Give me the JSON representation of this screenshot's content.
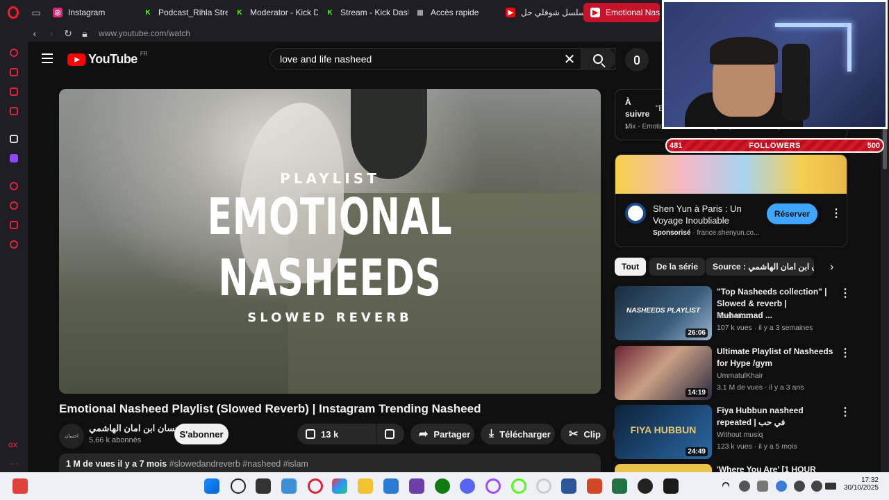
{
  "browser": {
    "tabs": [
      {
        "label": "Instagram",
        "color": "#d62976",
        "glyph": "◎"
      },
      {
        "label": "Podcast_Rihla Strea",
        "color": "#53fc18",
        "glyph": "K"
      },
      {
        "label": "Moderator - Kick D",
        "color": "#53fc18",
        "glyph": "K"
      },
      {
        "label": "Stream - Kick Dash",
        "color": "#53fc18",
        "glyph": "K"
      },
      {
        "label": "Accès rapide",
        "color": "#888888",
        "glyph": "▦"
      },
      {
        "label": "مسلسل شوفلي حل -",
        "color": "#ff0000",
        "glyph": "▶"
      },
      {
        "label": "Emotional Nas",
        "color": "#ff0000",
        "glyph": "▶"
      }
    ],
    "url": "www.youtube.com/watch"
  },
  "youtube": {
    "logo_text": "YouTube",
    "country": "FR",
    "search_value": "love and life nasheed",
    "video": {
      "overlay_playlist": "PLAYLIST",
      "overlay_line1": "EMOTIONAL",
      "overlay_line2": "NASHEEDS",
      "overlay_sub": "SLOWED REVERB",
      "title": "Emotional Nasheed Playlist (Slowed Reverb) | Instagram Trending Nasheed",
      "channel_name": "احسان ابن امان الهاشمي",
      "channel_avatar_text": "احسان",
      "subscribers": "5,66 k abonnés",
      "subscribe_label": "S'abonner",
      "likes": "13 k",
      "share_label": "Partager",
      "download_label": "Télécharger",
      "clip_label": "Clip",
      "views_date": "1 M de vues  il y a 7 mois",
      "tags": "#slowedandreverb #nasheed #islam"
    },
    "up_next": {
      "label": "À suivre :",
      "quote": "\"Be",
      "mix": "Mix - Emotional Nasheed Playlist (Slowed Reverb)"
    },
    "ad": {
      "title": "Shen Yun à Paris : Un Voyage Inoubliable",
      "sponsored": "Sponsorisé",
      "domain": "france.shenyun.co...",
      "button": "Réserver"
    },
    "chips": [
      "Tout",
      "De la série",
      "Source : احسان ابن امان الهاشمي"
    ],
    "recommendations": [
      {
        "title": "\"Top Nasheeds collection\" | Slowed & reverb | Muhammad ...",
        "channel": "Reebsticx",
        "meta": "107 k vues  ·  il y a 3 semaines",
        "duration": "26:06",
        "thumb_text": "NASHEEDS PLAYLIST"
      },
      {
        "title": "Ultimate Playlist of Nasheeds for Hype /gym",
        "channel": "UmmatulKhair",
        "meta": "3,1 M de vues  ·  il y a 3 ans",
        "duration": "14:19",
        "thumb_text": ""
      },
      {
        "title": "Fiya Hubbun nasheed repeated | في حب",
        "channel": "Without musiq",
        "meta": "123 k vues  ·  il y a 5 mois",
        "duration": "24:49",
        "thumb_text": "FIYA HUBBUN"
      },
      {
        "title": "'Where You Are' [1 HOUR",
        "channel": "",
        "meta": "",
        "duration": "",
        "thumb_text": ""
      }
    ]
  },
  "stream_overlay": {
    "followers_current": "481",
    "followers_label": "FOLLOWERS",
    "followers_goal": "500"
  },
  "taskbar": {
    "time": "17:32",
    "date": "30/10/2025"
  }
}
